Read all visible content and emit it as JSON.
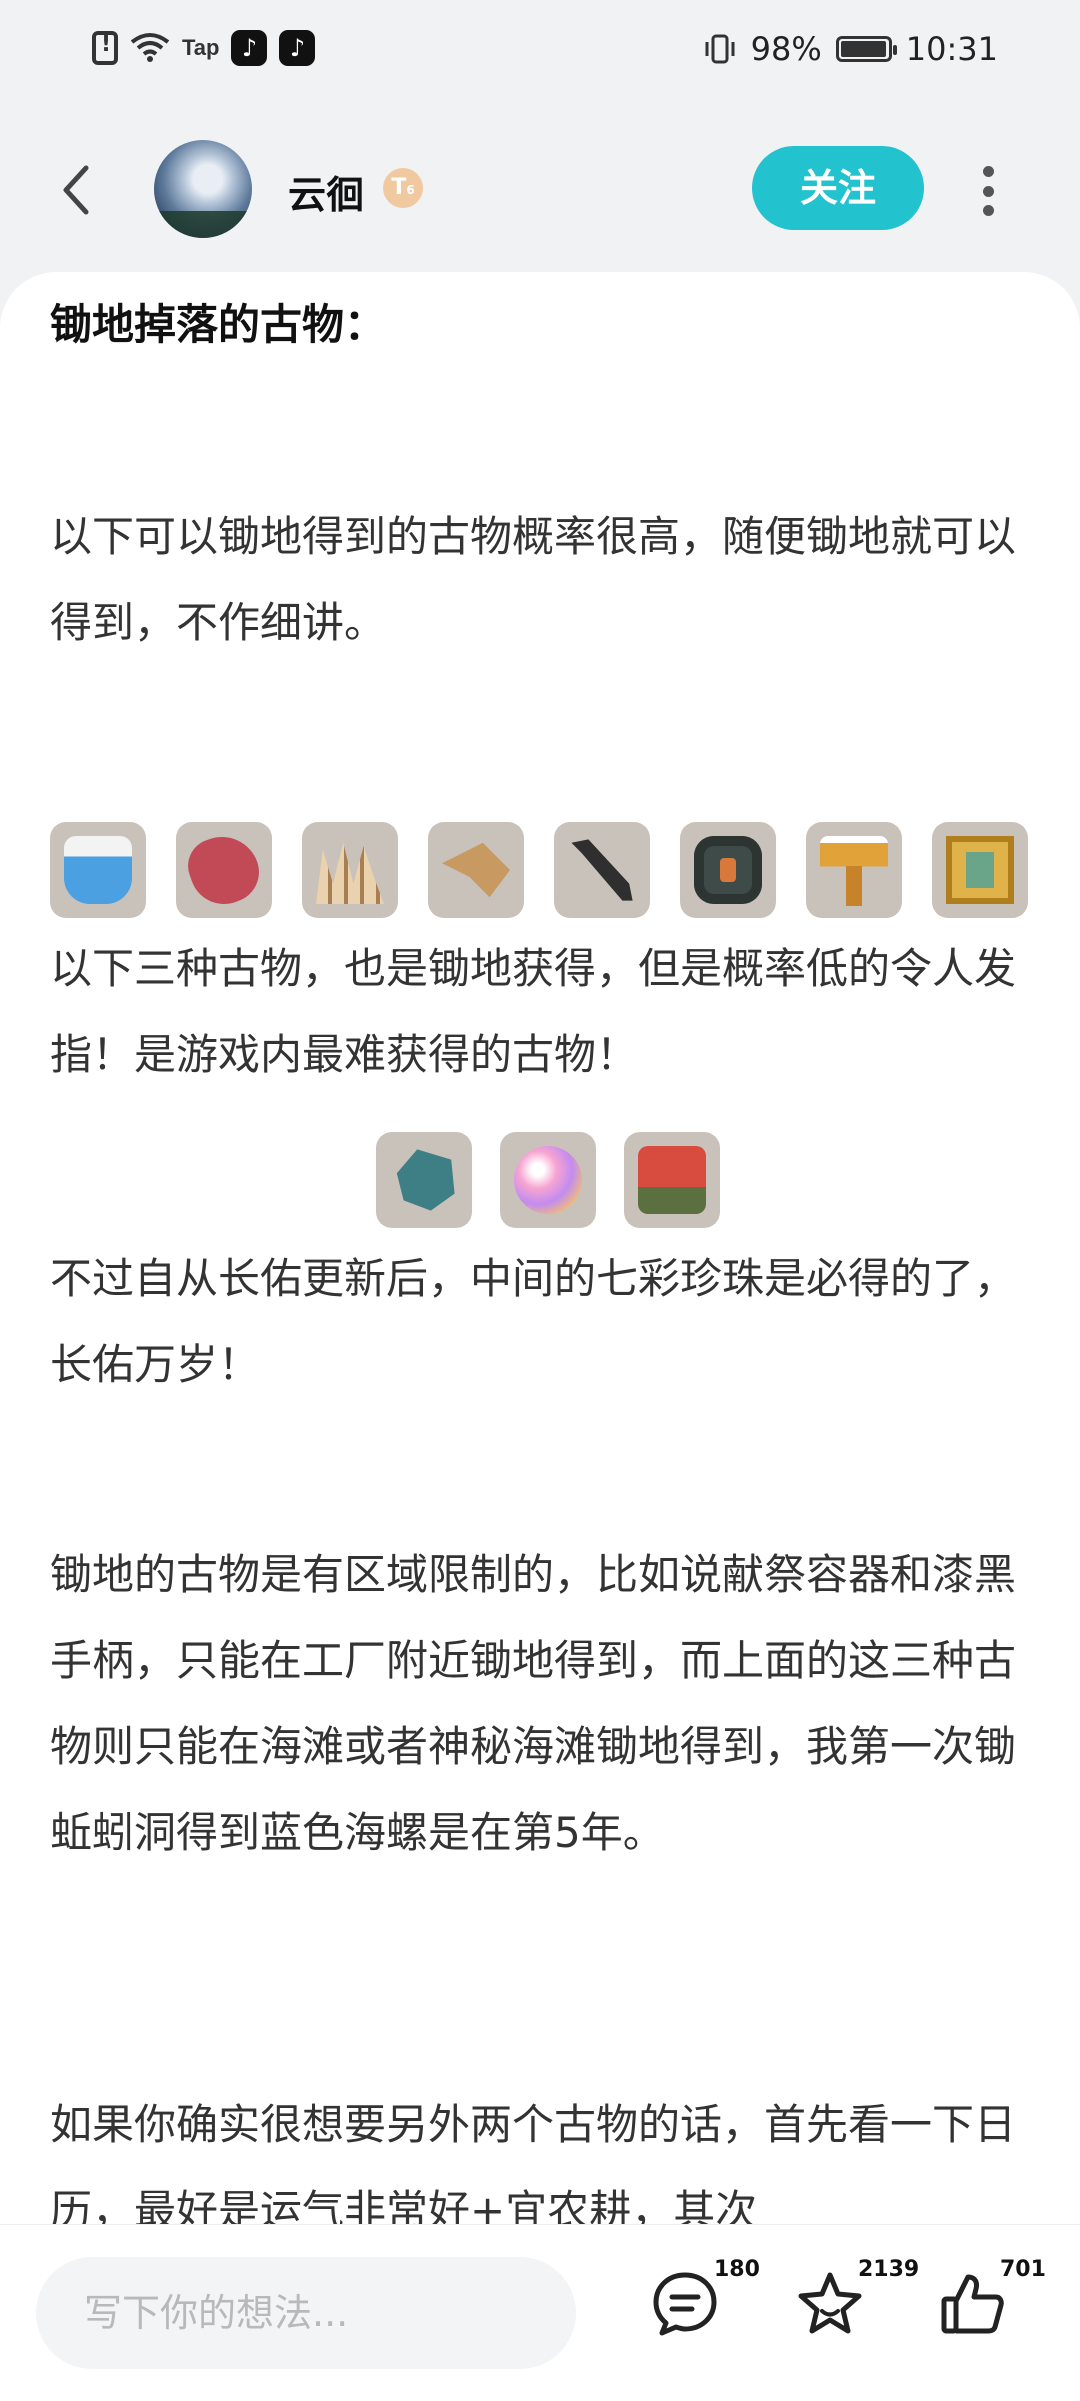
{
  "status_bar": {
    "tap_label": "Tap",
    "tiktok_glyph": "♪",
    "battery": "98%",
    "battery_level": 0.98,
    "time": "10:31"
  },
  "header": {
    "username": "云徊",
    "level_badge": "T",
    "level_num": "6",
    "follow_label": "关注"
  },
  "article": {
    "heading": "锄地掉落的古物：",
    "p1": "以下可以锄地得到的古物概率很高，随便锄地就可以得到，不作细讲。",
    "p2": "以下三种古物，也是锄地获得，但是概率低的令人发指！是游戏内最难获得的古物！",
    "p3": "不过自从长佑更新后，中间的七彩珍珠是必得的了，长佑万岁！",
    "p4": "锄地的古物是有区域限制的，比如说献祭容器和漆黑手柄，只能在工厂附近锄地得到，而上面的这三种古物则只能在海滩或者神秘海滩锄地得到，我第一次锄蚯蚓洞得到蓝色海螺是在第5年。",
    "p5": "如果你确实很想要另外两个古物的话，首先看一下日历，最好是运气非常好+宜农耕，其次"
  },
  "bottom_bar": {
    "comment_placeholder": "写下你的想法...",
    "comments_count": "180",
    "favorites_count": "2139",
    "likes_count": "701"
  }
}
